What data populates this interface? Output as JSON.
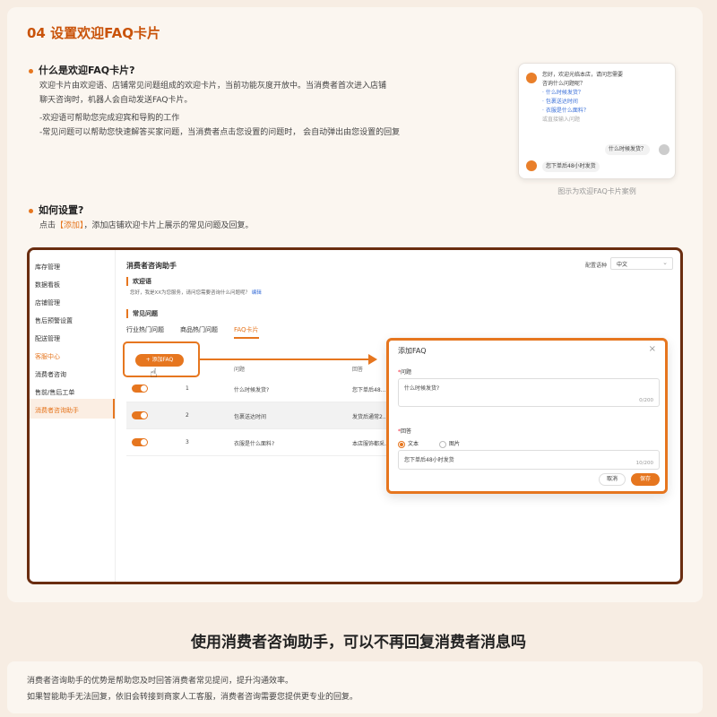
{
  "section": {
    "title": "04 设置欢迎FAQ卡片",
    "what": {
      "heading": "什么是欢迎FAQ卡片?",
      "line1": "欢迎卡片由欢迎语、店铺常见问题组成的欢迎卡片，当前功能灰度开放中。当消费者首次进入店铺",
      "line2": "聊天咨询时，机器人会自动发送FAQ卡片。",
      "point1": "-欢迎语可帮助您完成迎宾和导购的工作",
      "point2": "-常见问题可以帮助您快速解答买家问题，当消费者点击您设置的问题时， 会自动弹出由您设置的回复"
    },
    "how": {
      "heading": "如何设置?",
      "text_pre": "点击",
      "text_highlight": "【添加】",
      "text_post": "，添加店铺欢迎卡片上展示的常见问题及回复。"
    }
  },
  "preview": {
    "greeting_line1": "您好，欢迎光临本店，请问您需要",
    "greeting_line2": "咨询什么问题呢？",
    "link1": "· 什么时候发货？",
    "link2": "· 包裹送达时间",
    "link3": "· 衣服是什么面料？",
    "hint": "或直接输入问题",
    "user_msg": "什么时候发货？",
    "bot_reply": "您下单后48小时发货",
    "caption": "图示为欢迎FAQ卡片案例"
  },
  "app": {
    "sidebar": [
      "库存管理",
      "数据看板",
      "店铺管理",
      "售后预警设置",
      "配送管理",
      "客服中心",
      "消费者咨询",
      "售前/售后工单",
      "消费者咨询助手"
    ],
    "title": "消费者咨询助手",
    "lang_label": "配置语种",
    "lang_value": "中文",
    "welcome_heading": "欢迎语",
    "welcome_text": "您好，我是XX为您服务，请问您需要咨询什么问题呢？",
    "welcome_edit": "编辑",
    "faq_heading": "常见问题",
    "tabs": [
      "行业热门问题",
      "商品热门问题",
      "FAQ卡片"
    ],
    "add_button": "+ 添加FAQ",
    "columns": [
      "问题",
      "回答"
    ],
    "rows": [
      {
        "no": "1",
        "question": "什么时候发货?",
        "answer": "您下单后48..."
      },
      {
        "no": "2",
        "question": "包裹送达时间",
        "answer": "发货后通常2..."
      },
      {
        "no": "3",
        "question": "衣服是什么面料?",
        "answer": "本店服饰都采..."
      }
    ]
  },
  "dialog": {
    "title": "添加FAQ",
    "question_label": "问题",
    "question_value": "什么时候发货?",
    "question_count": "0/200",
    "answer_label": "回答",
    "option_text": "文本",
    "option_image": "图片",
    "answer_value": "您下单后48小时发货",
    "answer_count": "10/200",
    "cancel": "取消",
    "ok": "保存"
  },
  "bottom": {
    "title": "使用消费者咨询助手，可以不再回复消费者消息吗",
    "line1": "消费者咨询助手的优势是帮助您及时回答消费者常见提问，提升沟通效率。",
    "line2": "如果智能助手无法回复，依旧会转接到商家人工客服，消费者咨询需要您提供更专业的回复。"
  },
  "colors": {
    "accent": "#e6761f",
    "frame": "#6a2d10"
  }
}
